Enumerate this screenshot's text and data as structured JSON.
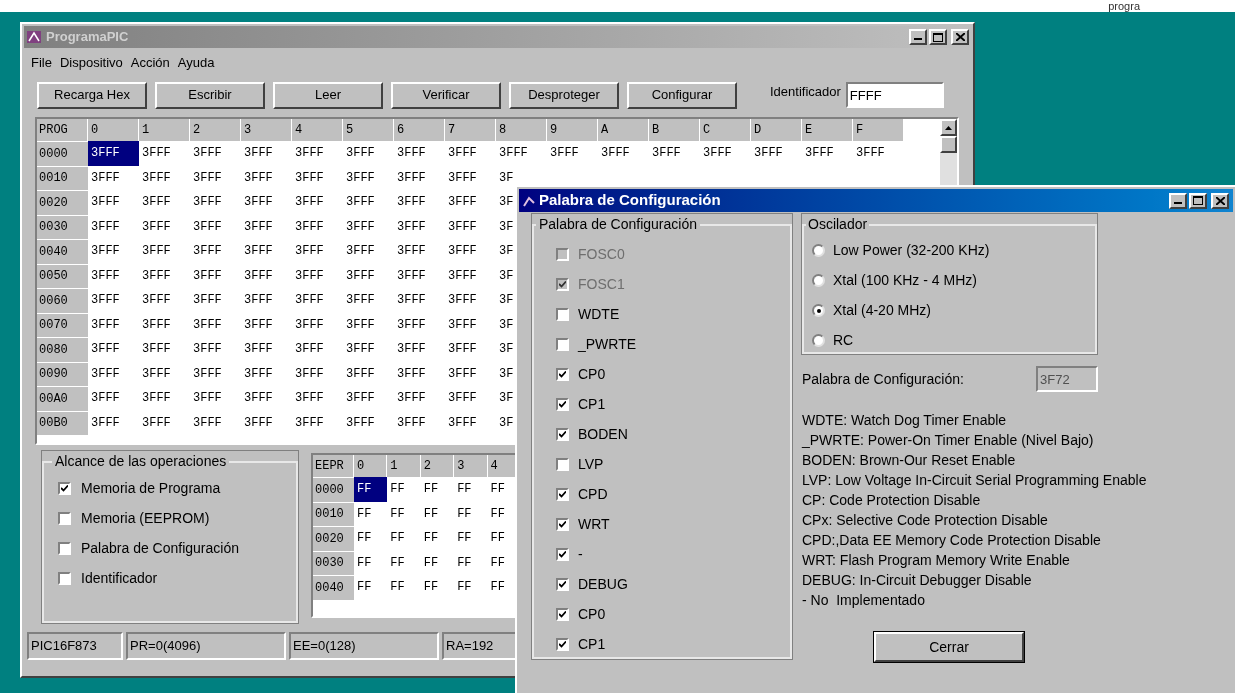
{
  "top_strip_text": "progra",
  "window": {
    "title": "ProgramaPIC",
    "menu": [
      "File",
      "Dispositivo",
      "Acción",
      "Ayuda"
    ],
    "toolbar": [
      "Recarga Hex",
      "Escribir",
      "Leer",
      "Verificar",
      "Desproteger",
      "Configurar"
    ],
    "identifier": {
      "label": "Identificador",
      "value": "FFFF"
    },
    "program_grid": {
      "corner": "PROG",
      "columns": [
        "0",
        "1",
        "2",
        "3",
        "4",
        "5",
        "6",
        "7",
        "8",
        "9",
        "A",
        "B",
        "C",
        "D",
        "E",
        "F"
      ],
      "rows": [
        {
          "address": "0000",
          "cells": [
            {
              "value": "3FFF",
              "selected": true
            },
            {
              "value": "3FFF",
              "selected": false
            },
            {
              "value": "3FFF",
              "selected": false
            },
            {
              "value": "3FFF",
              "selected": false
            },
            {
              "value": "3FFF",
              "selected": false
            },
            {
              "value": "3FFF",
              "selected": false
            },
            {
              "value": "3FFF",
              "selected": false
            },
            {
              "value": "3FFF",
              "selected": false
            },
            {
              "value": "3FFF",
              "selected": false
            },
            {
              "value": "3FFF",
              "selected": false
            },
            {
              "value": "3FFF",
              "selected": false
            },
            {
              "value": "3FFF",
              "selected": false
            },
            {
              "value": "3FFF",
              "selected": false
            },
            {
              "value": "3FFF",
              "selected": false
            },
            {
              "value": "3FFF",
              "selected": false
            },
            {
              "value": "3FFF",
              "selected": false
            }
          ]
        },
        {
          "address": "0010",
          "cells": [
            {
              "value": "3FFF",
              "selected": false
            },
            {
              "value": "3FFF",
              "selected": false
            },
            {
              "value": "3FFF",
              "selected": false
            },
            {
              "value": "3FFF",
              "selected": false
            },
            {
              "value": "3FFF",
              "selected": false
            },
            {
              "value": "3FFF",
              "selected": false
            },
            {
              "value": "3FFF",
              "selected": false
            },
            {
              "value": "3FFF",
              "selected": false
            },
            {
              "value": "3F",
              "selected": false
            }
          ]
        },
        {
          "address": "0020",
          "cells": [
            {
              "value": "3FFF",
              "selected": false
            },
            {
              "value": "3FFF",
              "selected": false
            },
            {
              "value": "3FFF",
              "selected": false
            },
            {
              "value": "3FFF",
              "selected": false
            },
            {
              "value": "3FFF",
              "selected": false
            },
            {
              "value": "3FFF",
              "selected": false
            },
            {
              "value": "3FFF",
              "selected": false
            },
            {
              "value": "3FFF",
              "selected": false
            },
            {
              "value": "3F",
              "selected": false
            }
          ]
        },
        {
          "address": "0030",
          "cells": [
            {
              "value": "3FFF",
              "selected": false
            },
            {
              "value": "3FFF",
              "selected": false
            },
            {
              "value": "3FFF",
              "selected": false
            },
            {
              "value": "3FFF",
              "selected": false
            },
            {
              "value": "3FFF",
              "selected": false
            },
            {
              "value": "3FFF",
              "selected": false
            },
            {
              "value": "3FFF",
              "selected": false
            },
            {
              "value": "3FFF",
              "selected": false
            },
            {
              "value": "3F",
              "selected": false
            }
          ]
        },
        {
          "address": "0040",
          "cells": [
            {
              "value": "3FFF",
              "selected": false
            },
            {
              "value": "3FFF",
              "selected": false
            },
            {
              "value": "3FFF",
              "selected": false
            },
            {
              "value": "3FFF",
              "selected": false
            },
            {
              "value": "3FFF",
              "selected": false
            },
            {
              "value": "3FFF",
              "selected": false
            },
            {
              "value": "3FFF",
              "selected": false
            },
            {
              "value": "3FFF",
              "selected": false
            },
            {
              "value": "3F",
              "selected": false
            }
          ]
        },
        {
          "address": "0050",
          "cells": [
            {
              "value": "3FFF",
              "selected": false
            },
            {
              "value": "3FFF",
              "selected": false
            },
            {
              "value": "3FFF",
              "selected": false
            },
            {
              "value": "3FFF",
              "selected": false
            },
            {
              "value": "3FFF",
              "selected": false
            },
            {
              "value": "3FFF",
              "selected": false
            },
            {
              "value": "3FFF",
              "selected": false
            },
            {
              "value": "3FFF",
              "selected": false
            },
            {
              "value": "3F",
              "selected": false
            }
          ]
        },
        {
          "address": "0060",
          "cells": [
            {
              "value": "3FFF",
              "selected": false
            },
            {
              "value": "3FFF",
              "selected": false
            },
            {
              "value": "3FFF",
              "selected": false
            },
            {
              "value": "3FFF",
              "selected": false
            },
            {
              "value": "3FFF",
              "selected": false
            },
            {
              "value": "3FFF",
              "selected": false
            },
            {
              "value": "3FFF",
              "selected": false
            },
            {
              "value": "3FFF",
              "selected": false
            },
            {
              "value": "3F",
              "selected": false
            }
          ]
        },
        {
          "address": "0070",
          "cells": [
            {
              "value": "3FFF",
              "selected": false
            },
            {
              "value": "3FFF",
              "selected": false
            },
            {
              "value": "3FFF",
              "selected": false
            },
            {
              "value": "3FFF",
              "selected": false
            },
            {
              "value": "3FFF",
              "selected": false
            },
            {
              "value": "3FFF",
              "selected": false
            },
            {
              "value": "3FFF",
              "selected": false
            },
            {
              "value": "3FFF",
              "selected": false
            },
            {
              "value": "3F",
              "selected": false
            }
          ]
        },
        {
          "address": "0080",
          "cells": [
            {
              "value": "3FFF",
              "selected": false
            },
            {
              "value": "3FFF",
              "selected": false
            },
            {
              "value": "3FFF",
              "selected": false
            },
            {
              "value": "3FFF",
              "selected": false
            },
            {
              "value": "3FFF",
              "selected": false
            },
            {
              "value": "3FFF",
              "selected": false
            },
            {
              "value": "3FFF",
              "selected": false
            },
            {
              "value": "3FFF",
              "selected": false
            },
            {
              "value": "3F",
              "selected": false
            }
          ]
        },
        {
          "address": "0090",
          "cells": [
            {
              "value": "3FFF",
              "selected": false
            },
            {
              "value": "3FFF",
              "selected": false
            },
            {
              "value": "3FFF",
              "selected": false
            },
            {
              "value": "3FFF",
              "selected": false
            },
            {
              "value": "3FFF",
              "selected": false
            },
            {
              "value": "3FFF",
              "selected": false
            },
            {
              "value": "3FFF",
              "selected": false
            },
            {
              "value": "3FFF",
              "selected": false
            },
            {
              "value": "3F",
              "selected": false
            }
          ]
        },
        {
          "address": "00A0",
          "cells": [
            {
              "value": "3FFF",
              "selected": false
            },
            {
              "value": "3FFF",
              "selected": false
            },
            {
              "value": "3FFF",
              "selected": false
            },
            {
              "value": "3FFF",
              "selected": false
            },
            {
              "value": "3FFF",
              "selected": false
            },
            {
              "value": "3FFF",
              "selected": false
            },
            {
              "value": "3FFF",
              "selected": false
            },
            {
              "value": "3FFF",
              "selected": false
            },
            {
              "value": "3F",
              "selected": false
            }
          ]
        },
        {
          "address": "00B0",
          "cells": [
            {
              "value": "3FFF",
              "selected": false
            },
            {
              "value": "3FFF",
              "selected": false
            },
            {
              "value": "3FFF",
              "selected": false
            },
            {
              "value": "3FFF",
              "selected": false
            },
            {
              "value": "3FFF",
              "selected": false
            },
            {
              "value": "3FFF",
              "selected": false
            },
            {
              "value": "3FFF",
              "selected": false
            },
            {
              "value": "3FFF",
              "selected": false
            },
            {
              "value": "3F",
              "selected": false
            }
          ]
        }
      ]
    },
    "scope": {
      "title": "Alcance de las operaciones",
      "options": [
        {
          "label": "Memoria de Programa",
          "checked": true
        },
        {
          "label": "Memoria (EEPROM)",
          "checked": false
        },
        {
          "label": "Palabra de Configuración",
          "checked": false
        },
        {
          "label": "Identificador",
          "checked": false
        }
      ]
    },
    "eeprom_grid": {
      "corner": "EEPR",
      "columns": [
        "0",
        "1",
        "2",
        "3",
        "4"
      ],
      "rows": [
        {
          "address": "0000",
          "cells": [
            {
              "value": "FF",
              "selected": true
            },
            {
              "value": "FF",
              "selected": false
            },
            {
              "value": "FF",
              "selected": false
            },
            {
              "value": "FF",
              "selected": false
            },
            {
              "value": "FF",
              "selected": false
            }
          ]
        },
        {
          "address": "0010",
          "cells": [
            {
              "value": "FF",
              "selected": false
            },
            {
              "value": "FF",
              "selected": false
            },
            {
              "value": "FF",
              "selected": false
            },
            {
              "value": "FF",
              "selected": false
            },
            {
              "value": "FF",
              "selected": false
            }
          ]
        },
        {
          "address": "0020",
          "cells": [
            {
              "value": "FF",
              "selected": false
            },
            {
              "value": "FF",
              "selected": false
            },
            {
              "value": "FF",
              "selected": false
            },
            {
              "value": "FF",
              "selected": false
            },
            {
              "value": "FF",
              "selected": false
            }
          ]
        },
        {
          "address": "0030",
          "cells": [
            {
              "value": "FF",
              "selected": false
            },
            {
              "value": "FF",
              "selected": false
            },
            {
              "value": "FF",
              "selected": false
            },
            {
              "value": "FF",
              "selected": false
            },
            {
              "value": "FF",
              "selected": false
            }
          ]
        },
        {
          "address": "0040",
          "cells": [
            {
              "value": "FF",
              "selected": false
            },
            {
              "value": "FF",
              "selected": false
            },
            {
              "value": "FF",
              "selected": false
            },
            {
              "value": "FF",
              "selected": false
            },
            {
              "value": "FF",
              "selected": false
            }
          ]
        }
      ]
    },
    "status_bar": [
      "PIC16F873",
      "PR=0(4096)",
      "EE=0(128)",
      "RA=192"
    ]
  },
  "dialog": {
    "title": "Palabra de Configuración",
    "bits_group": {
      "title": "Palabra de Configuración",
      "bits": [
        {
          "label": "FOSC0",
          "checked": false,
          "disabled": true
        },
        {
          "label": "FOSC1",
          "checked": true,
          "disabled": true
        },
        {
          "label": "WDTE",
          "checked": false,
          "disabled": false
        },
        {
          "label": "_PWRTE",
          "checked": false,
          "disabled": false
        },
        {
          "label": "CP0",
          "checked": true,
          "disabled": false
        },
        {
          "label": "CP1",
          "checked": true,
          "disabled": false
        },
        {
          "label": "BODEN",
          "checked": true,
          "disabled": false
        },
        {
          "label": "LVP",
          "checked": false,
          "disabled": false
        },
        {
          "label": "CPD",
          "checked": true,
          "disabled": false
        },
        {
          "label": "WRT",
          "checked": true,
          "disabled": false
        },
        {
          "label": "-",
          "checked": true,
          "disabled": false
        },
        {
          "label": "DEBUG",
          "checked": true,
          "disabled": false
        },
        {
          "label": "CP0",
          "checked": true,
          "disabled": false
        },
        {
          "label": "CP1",
          "checked": true,
          "disabled": false
        }
      ]
    },
    "oscillator": {
      "title": "Oscilador",
      "options": [
        {
          "label": "Low Power (32-200 KHz)",
          "selected": false
        },
        {
          "label": "Xtal (100 KHz - 4 MHz)",
          "selected": false
        },
        {
          "label": "Xtal (4-20 MHz)",
          "selected": true
        },
        {
          "label": "RC",
          "selected": false
        }
      ]
    },
    "word": {
      "label": "Palabra de Configuración:",
      "value": "3F72"
    },
    "notes": [
      "WDTE: Watch Dog Timer Enable",
      "_PWRTE: Power-On Timer Enable (Nivel Bajo)",
      "BODEN: Brown-Our Reset Enable",
      "LVP: Low Voltage In-Circuit Serial Programming Enable",
      "CP: Code Protection Disable",
      "CPx: Selective Code Protection Disable",
      "CPD:,Data EE Memory Code Protection Disable",
      "WRT: Flash Program Memory Write Enable",
      "DEBUG: In-Circuit Debugger Disable",
      "- No  Implementado"
    ],
    "close_button": "Cerrar"
  }
}
